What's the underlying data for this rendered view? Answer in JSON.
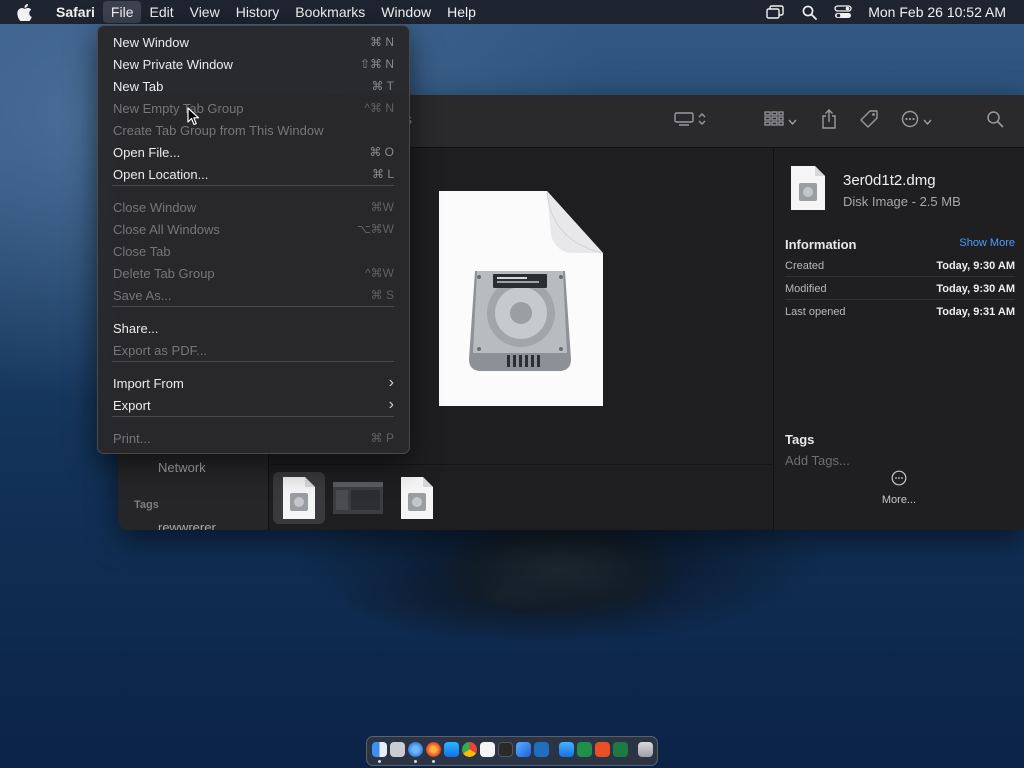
{
  "menubar": {
    "app_name": "Safari",
    "items": [
      "File",
      "Edit",
      "View",
      "History",
      "Bookmarks",
      "Window",
      "Help"
    ],
    "active_item": "File",
    "clock": "Mon Feb 26  10:52 AM",
    "status_icons": [
      "screen-mirroring-icon",
      "search-icon",
      "control-center-icon"
    ]
  },
  "file_menu": {
    "items": [
      {
        "label": "New Window",
        "shortcut": "⌘ N",
        "enabled": true
      },
      {
        "label": "New Private Window",
        "shortcut": "⇧⌘ N",
        "enabled": true
      },
      {
        "label": "New Tab",
        "shortcut": "⌘ T",
        "enabled": true
      },
      {
        "label": "New Empty Tab Group",
        "shortcut": "^⌘ N",
        "enabled": false
      },
      {
        "label": "Create Tab Group from This Window",
        "shortcut": "",
        "enabled": false
      },
      {
        "label": "Open File...",
        "shortcut": "⌘ O",
        "enabled": true
      },
      {
        "label": "Open Location...",
        "shortcut": "⌘ L",
        "enabled": true
      },
      {
        "label": "Close Window",
        "shortcut": "⌘W",
        "enabled": false
      },
      {
        "label": "Close All Windows",
        "shortcut": "⌥⌘W",
        "enabled": false
      },
      {
        "label": "Close Tab",
        "shortcut": "",
        "enabled": false
      },
      {
        "label": "Delete Tab Group",
        "shortcut": "^⌘W",
        "enabled": false
      },
      {
        "label": "Save As...",
        "shortcut": "⌘ S",
        "enabled": false
      },
      {
        "label": "Share...",
        "shortcut": "",
        "enabled": true
      },
      {
        "label": "Export as PDF...",
        "shortcut": "",
        "enabled": false
      },
      {
        "label": "Import From",
        "shortcut": "›",
        "enabled": true
      },
      {
        "label": "Export",
        "shortcut": "›",
        "enabled": true
      },
      {
        "label": "Print...",
        "shortcut": "⌘ P",
        "enabled": false
      }
    ]
  },
  "finder": {
    "sidebar": {
      "network_label": "Network",
      "tags_header": "Tags",
      "tag_item": "rewwrerer"
    },
    "inspector": {
      "file_name": "3er0d1t2.dmg",
      "file_kind": "Disk Image - 2.5 MB",
      "information_title": "Information",
      "show_more": "Show More",
      "rows": [
        {
          "key": "Created",
          "value": "Today, 9:30 AM"
        },
        {
          "key": "Modified",
          "value": "Today, 9:30 AM"
        },
        {
          "key": "Last opened",
          "value": "Today, 9:31 AM"
        }
      ],
      "tags_title": "Tags",
      "add_tags_placeholder": "Add Tags...",
      "more_label": "More..."
    },
    "toolbar_fragment": "s"
  },
  "dock": {
    "icons": [
      "finder-icon",
      "launchpad-icon",
      "safari-icon",
      "firefox-icon",
      "app-store-icon",
      "chrome-icon",
      "textedit-icon",
      "terminal-icon",
      "xcode-icon",
      "vscode-icon",
      "mail-icon",
      "excel-icon",
      "office-icon",
      "excel-icon-2",
      "trash-icon"
    ]
  }
}
